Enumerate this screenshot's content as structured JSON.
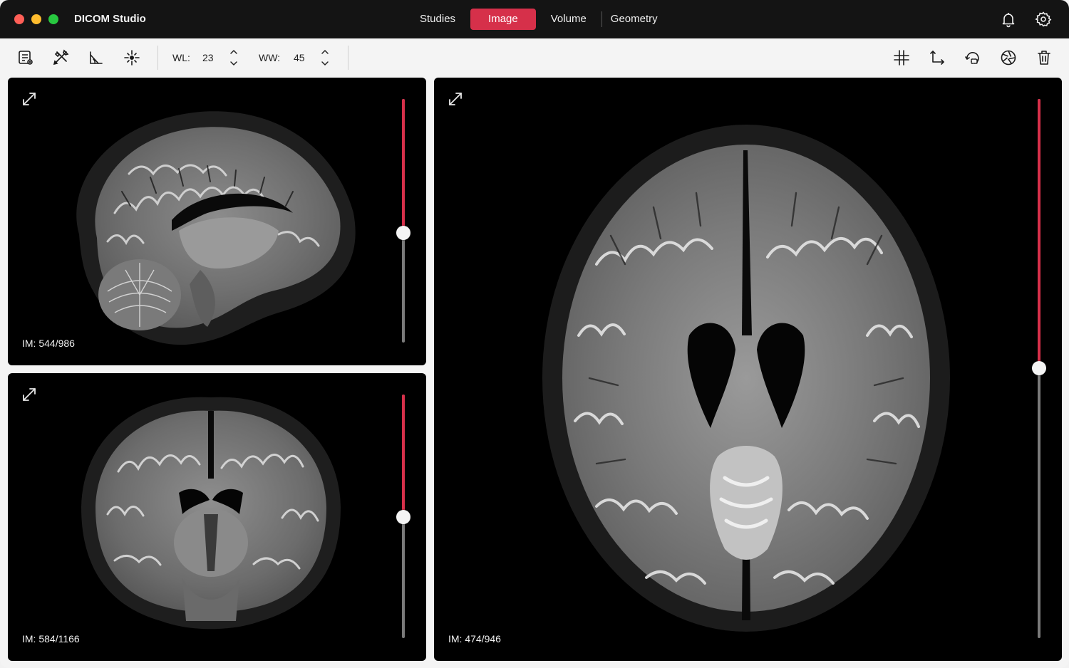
{
  "window": {
    "title": "DICOM Studio"
  },
  "nav": {
    "tabs": [
      {
        "label": "Studies",
        "active": false
      },
      {
        "label": "Image",
        "active": true
      },
      {
        "label": "Volume",
        "active": false
      },
      {
        "label": "Geometry",
        "active": false
      }
    ]
  },
  "titlebar_icons": [
    "bell-icon",
    "gear-icon"
  ],
  "toolbar": {
    "left_tools": [
      "report-icon",
      "tools-icon",
      "angle-measure-icon",
      "crosshair-icon"
    ],
    "wl_label": "WL:",
    "wl_value": "23",
    "ww_label": "WW:",
    "ww_value": "45",
    "right_tools": [
      "grid-icon",
      "axes-icon",
      "rotate-icon",
      "aperture-icon",
      "trash-icon"
    ]
  },
  "viewports": {
    "sagittal": {
      "image_label": "IM: 544/986",
      "slice": 544,
      "total": 986
    },
    "coronal": {
      "image_label": "IM: 584/1166",
      "slice": 584,
      "total": 1166
    },
    "axial": {
      "image_label": "IM: 474/946",
      "slice": 474,
      "total": 946
    }
  },
  "colors": {
    "accent": "#d6304a",
    "titlebar": "#141414",
    "viewport_bg": "#000000"
  }
}
